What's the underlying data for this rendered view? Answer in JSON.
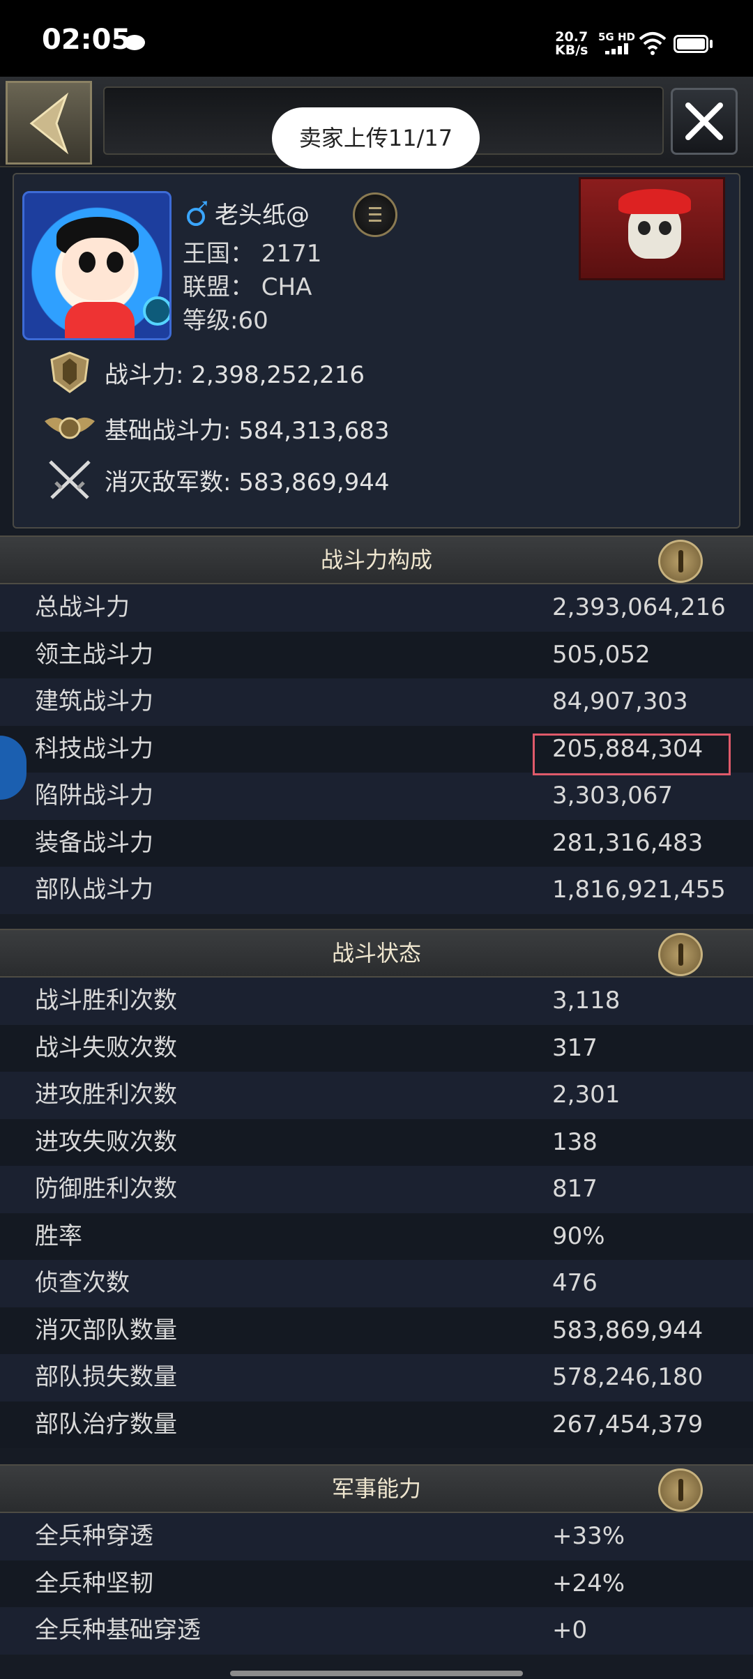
{
  "status_bar": {
    "time": "02:05",
    "speed_value": "20.7",
    "speed_unit": "KB/s",
    "network": "5G HD",
    "icons": [
      "wechat-icon",
      "signal-icon",
      "wifi-icon",
      "battery-icon"
    ]
  },
  "toast": "卖家上传11/17",
  "profile": {
    "name": "老头纸@",
    "kingdom": "王国：  2171",
    "alliance": "联盟：  CHA",
    "level": "等级:60",
    "power": "战斗力: 2,398,252,216",
    "base_power": "基础战斗力: 584,313,683",
    "kills": "消灭敌军数: 583,869,944"
  },
  "sections": {
    "composition": {
      "title": "战斗力构成",
      "rows": [
        {
          "label": "总战斗力",
          "value": "2,393,064,216"
        },
        {
          "label": "领主战斗力",
          "value": "505,052"
        },
        {
          "label": "建筑战斗力",
          "value": "84,907,303"
        },
        {
          "label": "科技战斗力",
          "value": "205,884,304"
        },
        {
          "label": "陷阱战斗力",
          "value": "3,303,067"
        },
        {
          "label": "装备战斗力",
          "value": "281,316,483"
        },
        {
          "label": "部队战斗力",
          "value": "1,816,921,455"
        }
      ]
    },
    "battle": {
      "title": "战斗状态",
      "rows": [
        {
          "label": "战斗胜利次数",
          "value": "3,118"
        },
        {
          "label": "战斗失败次数",
          "value": "317"
        },
        {
          "label": "进攻胜利次数",
          "value": "2,301"
        },
        {
          "label": "进攻失败次数",
          "value": "138"
        },
        {
          "label": "防御胜利次数",
          "value": "817"
        },
        {
          "label": "胜率",
          "value": "90%"
        },
        {
          "label": "侦查次数",
          "value": "476"
        },
        {
          "label": "消灭部队数量",
          "value": "583,869,944"
        },
        {
          "label": "部队损失数量",
          "value": "578,246,180"
        },
        {
          "label": "部队治疗数量",
          "value": "267,454,379"
        }
      ]
    },
    "military": {
      "title": "军事能力",
      "rows": [
        {
          "label": "全兵种穿透",
          "value": "+33%"
        },
        {
          "label": "全兵种坚韧",
          "value": "+24%"
        },
        {
          "label": "全兵种基础穿透",
          "value": "+0"
        }
      ]
    }
  },
  "colors": {
    "background": "#161b24",
    "highlight": "#e05a6a",
    "header_text": "#efe6cf"
  }
}
